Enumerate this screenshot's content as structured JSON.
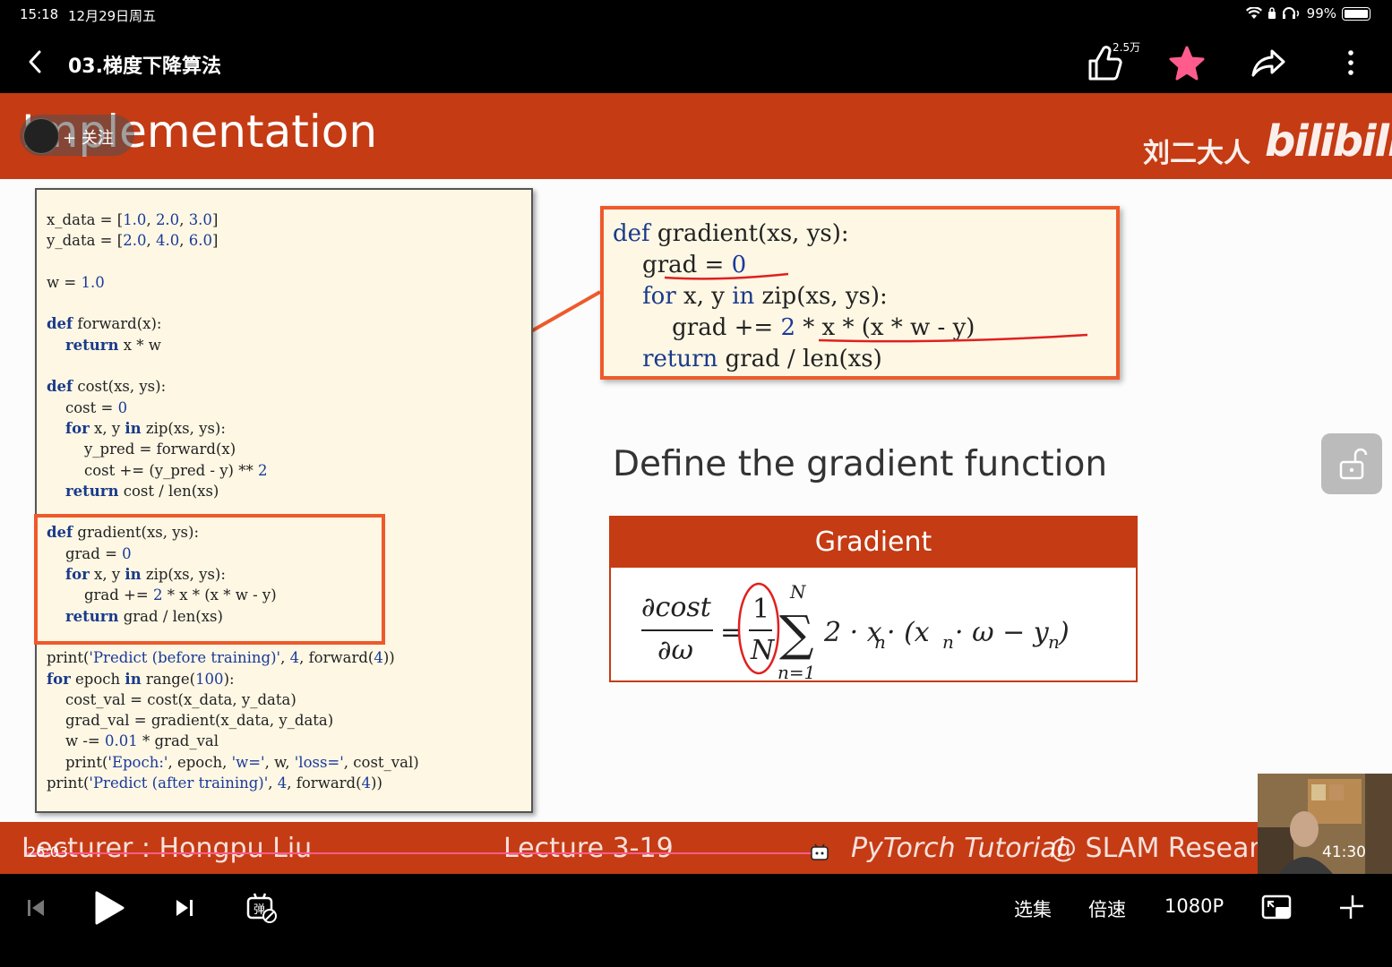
{
  "status": {
    "time": "15:18",
    "date": "12月29日周五",
    "battery": "99%"
  },
  "nav": {
    "title": "03.梯度下降算法",
    "like_count": "2.5万"
  },
  "slide": {
    "title": "Implementation",
    "follow_label": "+ 关注",
    "watermark_name": "刘二大人",
    "watermark_logo": "bilibili",
    "define_text": "Define the gradient function",
    "gradient_title": "Gradient",
    "footer_lecturer": "Lecturer : Hongpu Liu",
    "footer_lecture": "Lecture 3-19",
    "footer_tutorial": "PyTorch Tutorial",
    "footer_slam": " @ SLAM Resear"
  },
  "player": {
    "current_time": "26:03",
    "total_time": "41:30",
    "progress": 0.628
  },
  "controls": {
    "episodes": "选集",
    "speed": "倍速",
    "quality": "1080P"
  },
  "colors": {
    "accent": "#c53b14",
    "highlight": "#ee5a2b",
    "progress": "#ff5a8a",
    "favorite": "#ff5c8d"
  }
}
